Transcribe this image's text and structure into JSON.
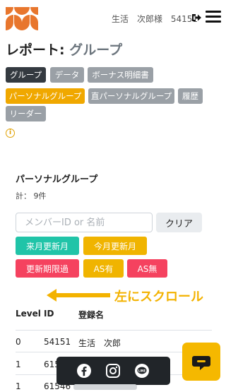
{
  "header": {
    "user_name": "生活　次郎様",
    "user_id": "54151"
  },
  "page": {
    "title": "レポート:",
    "subtitle": "グループ"
  },
  "nav": {
    "row1": [
      "グループ",
      "データ",
      "ボーナス明細書"
    ],
    "row2": [
      "パーソナルグループ",
      "直パーソナルグループ",
      "履歴"
    ],
    "row3": [
      "リーダー"
    ]
  },
  "section": {
    "title": "パーソナルグループ",
    "count": "計： 9件"
  },
  "search": {
    "placeholder": "メンバーID or 名前",
    "value": "",
    "clear_label": "クリア"
  },
  "filters": {
    "next_month": "来月更新月",
    "this_month": "今月更新月",
    "overdue": "更新期限過",
    "as_yes": "AS有",
    "as_no": "AS無"
  },
  "scroll_hint": "左にスクロール",
  "table": {
    "headers": [
      "Level",
      "ID",
      "登録名"
    ],
    "rows": [
      [
        "0",
        "54151",
        "生活　次郎"
      ],
      [
        "1",
        "615",
        ""
      ],
      [
        "1",
        "61546",
        ""
      ]
    ]
  },
  "colors": {
    "accent": "#f0a800",
    "dark": "#343a40",
    "gray": "#9aa0a6",
    "teal": "#20c4a8",
    "red": "#f5425f",
    "logo": "#e8762d"
  },
  "icons": {
    "logout": "sign-out-icon",
    "menu": "hamburger-icon",
    "info": "info-circle-icon",
    "facebook": "facebook-icon",
    "instagram": "instagram-icon",
    "line": "line-icon",
    "chat": "chat-icon"
  }
}
